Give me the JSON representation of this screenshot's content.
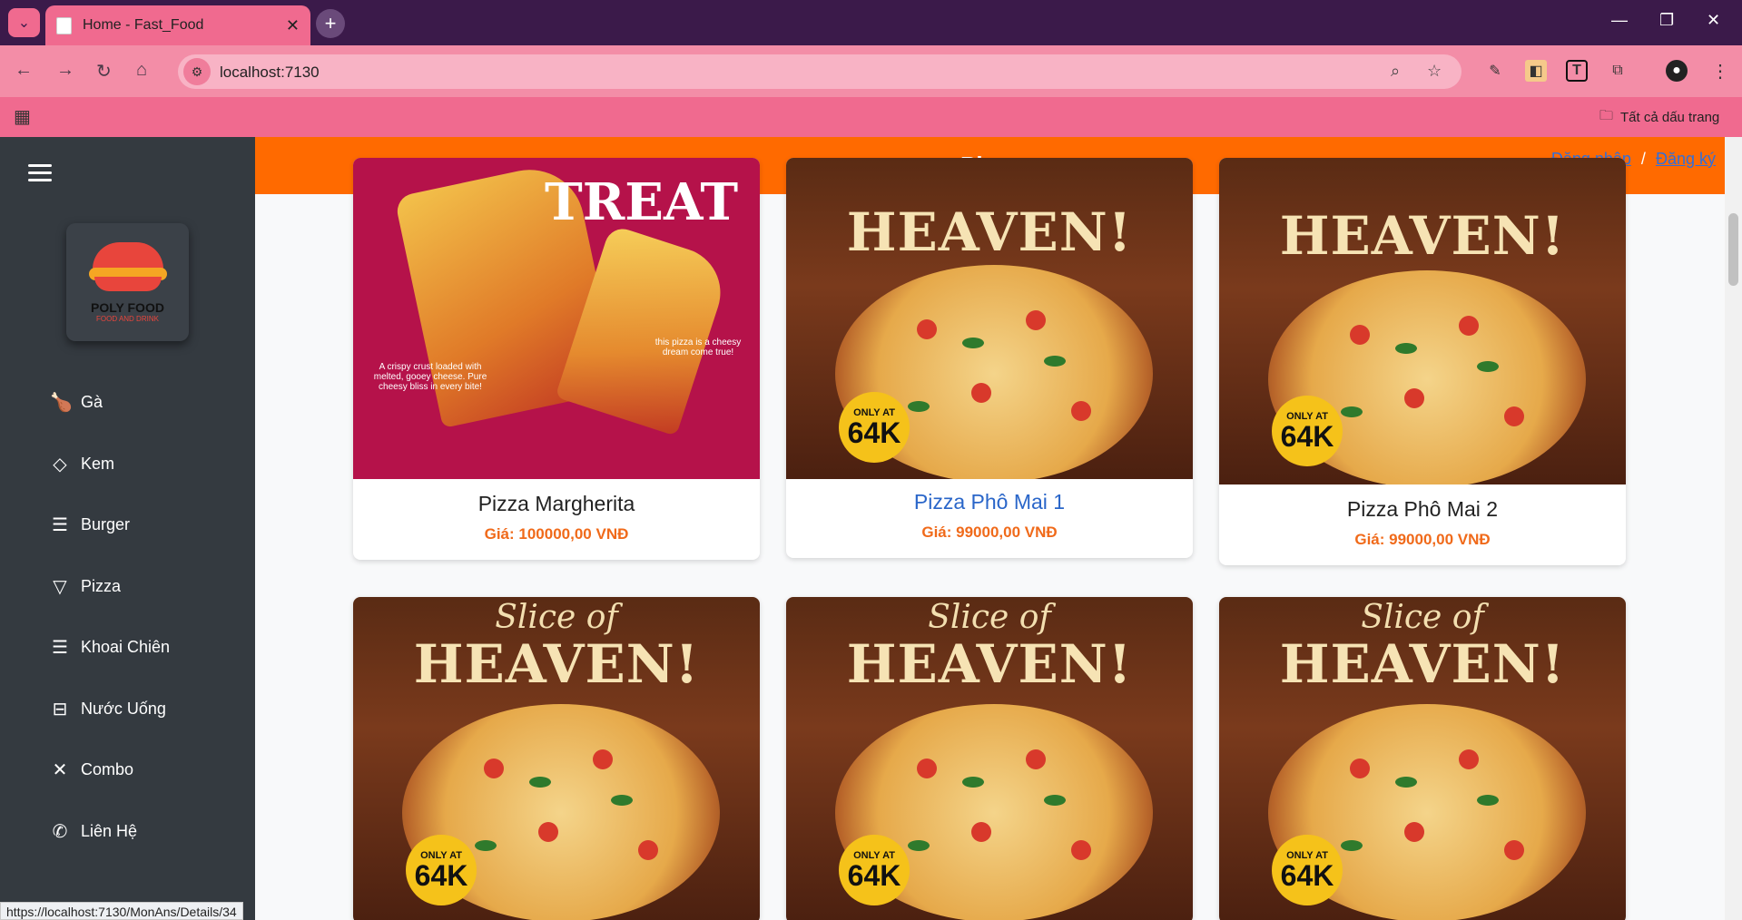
{
  "browser": {
    "tab_title": "Home - Fast_Food",
    "url": "localhost:7130",
    "bookmarks_label": "Tất cả dấu trang",
    "status_url": "https://localhost:7130/MonAns/Details/34"
  },
  "sidebar": {
    "logo_brand": "POLY FOOD",
    "logo_tagline": "FOOD AND DRINK",
    "items": [
      {
        "label": "Gà",
        "icon": "chicken-leg-icon"
      },
      {
        "label": "Kem",
        "icon": "ice-cream-icon"
      },
      {
        "label": "Burger",
        "icon": "burger-icon"
      },
      {
        "label": "Pizza",
        "icon": "pizza-icon"
      },
      {
        "label": "Khoai Chiên",
        "icon": "fries-icon"
      },
      {
        "label": "Nước Uống",
        "icon": "drink-icon"
      },
      {
        "label": "Combo",
        "icon": "utensils-icon"
      },
      {
        "label": "Liên Hệ",
        "icon": "phone-icon"
      }
    ]
  },
  "header": {
    "title": "Pizza",
    "login": "Đăng nhập",
    "separator": "/",
    "register": "Đăng ký"
  },
  "products": [
    {
      "name": "Pizza Margherita",
      "price": "Giá: 100000,00 VNĐ",
      "poster_title": "TREAT",
      "poster_note_left": "A crispy crust loaded with melted, gooey cheese. Pure cheesy bliss in every bite!",
      "poster_note_right": "this pizza is a cheesy dream come true!"
    },
    {
      "name": "Pizza Phô Mai 1",
      "price": "Giá: 99000,00 VNĐ",
      "poster_title": "HEAVEN!",
      "badge_top": "ONLY AT",
      "badge_price": "64K"
    },
    {
      "name": "Pizza Phô Mai 2",
      "price": "Giá: 99000,00 VNĐ",
      "poster_title": "HEAVEN!",
      "badge_top": "ONLY AT",
      "badge_price": "64K"
    },
    {
      "poster_script": "Slice of",
      "poster_title": "HEAVEN!",
      "badge_top": "ONLY AT",
      "badge_price": "64K"
    },
    {
      "poster_script": "Slice of",
      "poster_title": "HEAVEN!",
      "badge_top": "ONLY AT",
      "badge_price": "64K"
    },
    {
      "poster_script": "Slice of",
      "poster_title": "HEAVEN!",
      "badge_top": "ONLY AT",
      "badge_price": "64K"
    }
  ],
  "colors": {
    "header": "#ff6a00",
    "sidebar": "#343a40",
    "price": "#f06a1a",
    "chrome": "#f06a8f"
  }
}
